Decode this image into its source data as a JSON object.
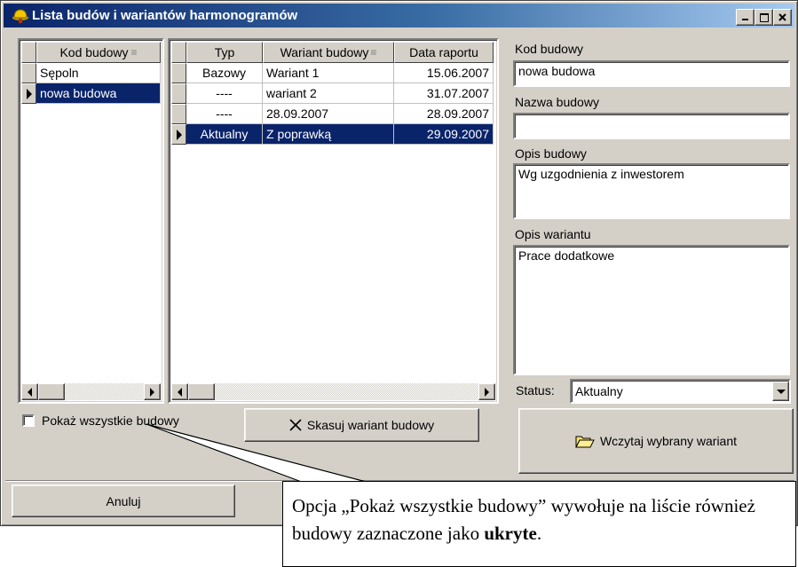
{
  "window": {
    "title": "Lista budów i wariantów harmonogramów"
  },
  "construction_list": {
    "header": "Kod budowy",
    "rows": [
      {
        "code": "Sępoln",
        "selected": false
      },
      {
        "code": "nowa budowa",
        "selected": true
      }
    ]
  },
  "variant_list": {
    "headers": {
      "type": "Typ",
      "variant": "Wariant budowy",
      "date": "Data raportu"
    },
    "rows": [
      {
        "type": "Bazowy",
        "variant": "Wariant 1",
        "date": "15.06.2007"
      },
      {
        "type": "----",
        "variant": "wariant 2",
        "date": "31.07.2007"
      },
      {
        "type": "----",
        "variant": "28.09.2007",
        "date": "28.09.2007"
      },
      {
        "type": "Aktualny",
        "variant": "Z poprawką",
        "date": "29.09.2007"
      }
    ]
  },
  "form": {
    "code_label": "Kod budowy",
    "code_value": "nowa budowa",
    "name_label": "Nazwa budowy",
    "name_value": "",
    "description_label": "Opis budowy",
    "description_value": "Wg uzgodnienia z inwestorem",
    "variant_description_label": "Opis wariantu",
    "variant_description_value": "Prace dodatkowe",
    "status_label": "Status:",
    "status_value": "Aktualny"
  },
  "controls": {
    "show_all_label": "Pokaż wszystkie budowy",
    "show_all_checked": false,
    "delete_variant_label": "Skasuj wariant budowy",
    "load_variant_label": "Wczytaj wybrany wariant",
    "cancel_label": "Anuluj"
  },
  "callout": {
    "text_before": "Opcja „Pokaż wszystkie budowy” wywołuje na liście również budowy zaznaczone jako ",
    "bold": "ukryte",
    "text_after": "."
  },
  "colors": {
    "title_start": "#0a246a",
    "title_end": "#a6caf0",
    "selection": "#0a246a",
    "face": "#d4d0c8"
  }
}
